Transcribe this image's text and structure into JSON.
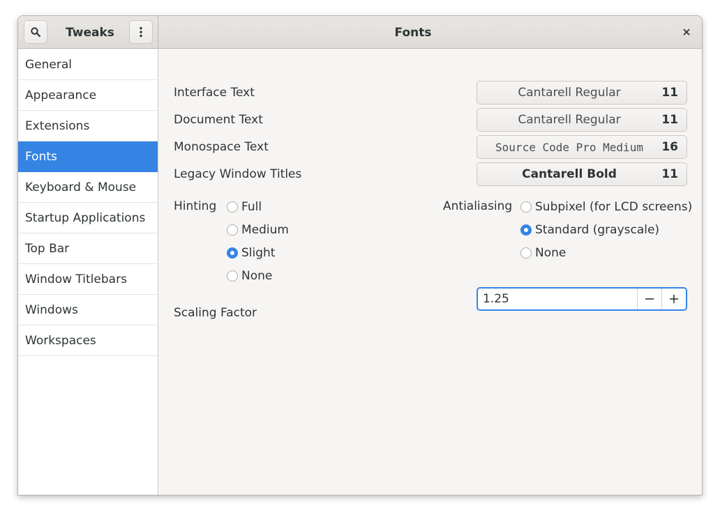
{
  "app": {
    "title": "Tweaks",
    "page_title": "Fonts",
    "accent_color": "#3584e4"
  },
  "header": {
    "search_icon": "search-icon",
    "menu_icon": "vertical-ellipsis-icon",
    "close_icon": "close-icon"
  },
  "sidebar": {
    "items": [
      {
        "label": "General"
      },
      {
        "label": "Appearance"
      },
      {
        "label": "Extensions"
      },
      {
        "label": "Fonts",
        "selected": true
      },
      {
        "label": "Keyboard & Mouse"
      },
      {
        "label": "Startup Applications"
      },
      {
        "label": "Top Bar"
      },
      {
        "label": "Window Titlebars"
      },
      {
        "label": "Windows"
      },
      {
        "label": "Workspaces"
      }
    ]
  },
  "fonts": {
    "interface": {
      "label": "Interface Text",
      "font": "Cantarell Regular",
      "size": "11"
    },
    "document": {
      "label": "Document Text",
      "font": "Cantarell Regular",
      "size": "11"
    },
    "monospace": {
      "label": "Monospace Text",
      "font": "Source Code Pro Medium",
      "size": "16"
    },
    "legacy": {
      "label": "Legacy Window Titles",
      "font": "Cantarell Bold",
      "size": "11"
    }
  },
  "hinting": {
    "label": "Hinting",
    "options": [
      {
        "label": "Full",
        "checked": false
      },
      {
        "label": "Medium",
        "checked": false
      },
      {
        "label": "Slight",
        "checked": true
      },
      {
        "label": "None",
        "checked": false
      }
    ]
  },
  "antialiasing": {
    "label": "Antialiasing",
    "options": [
      {
        "label": "Subpixel (for LCD screens)",
        "checked": false
      },
      {
        "label": "Standard (grayscale)",
        "checked": true
      },
      {
        "label": "None",
        "checked": false
      }
    ]
  },
  "scaling": {
    "label": "Scaling Factor",
    "value": "1.25",
    "minus_icon": "minus-icon",
    "plus_icon": "plus-icon"
  }
}
